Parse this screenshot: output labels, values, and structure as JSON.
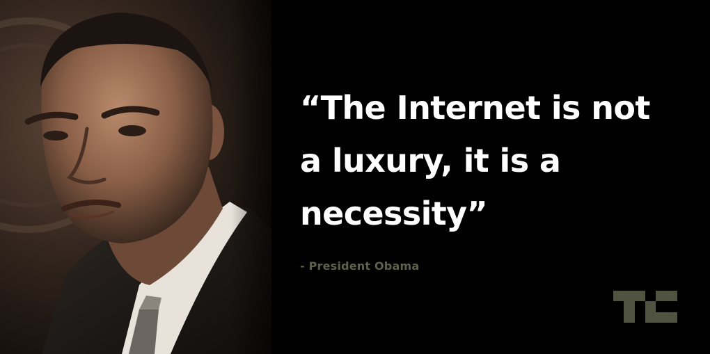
{
  "quote": {
    "text": "“The Internet is not\na luxury, it is a\nnecessity”",
    "attribution": "- President Obama"
  },
  "portrait": {
    "icon": "portrait-photo"
  },
  "logo": {
    "icon": "techcrunch-logo",
    "color": "#4f5340"
  },
  "colors": {
    "background": "#000000",
    "quote_text": "#ffffff",
    "attribution_text": "#5d6149"
  }
}
